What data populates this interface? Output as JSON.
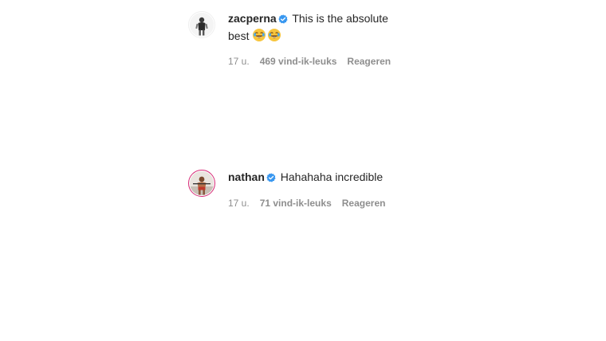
{
  "comments": [
    {
      "username": "zacperna",
      "verified": true,
      "text_line1": "This is the absolute",
      "text_line2": "best",
      "emojis": [
        "face-with-tears-of-joy",
        "face-with-tears-of-joy"
      ],
      "time": "17 u.",
      "likes": "469 vind-ik-leuks",
      "reply_label": "Reageren"
    },
    {
      "username": "nathan",
      "verified": true,
      "text": "Hahahaha incredible",
      "time": "17 u.",
      "likes": "71 vind-ik-leuks",
      "reply_label": "Reageren"
    }
  ],
  "colors": {
    "verified_badge": "#3897f0",
    "story_ring": "#d62976",
    "meta_text": "#8e8e8e"
  }
}
